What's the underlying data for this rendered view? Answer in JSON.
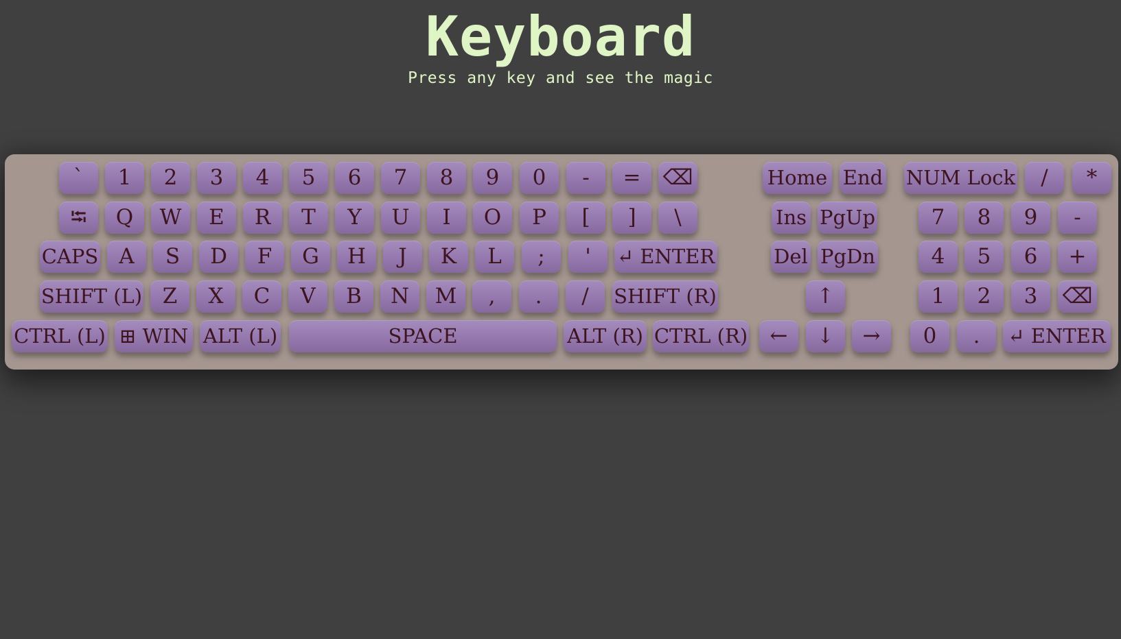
{
  "header": {
    "title": "Keyboard",
    "subtitle": "Press any key and see the magic"
  },
  "keyboard": {
    "main_rows": [
      [
        "`",
        "1",
        "2",
        "3",
        "4",
        "5",
        "6",
        "7",
        "8",
        "9",
        "0",
        "-",
        "=",
        "⌫"
      ],
      [
        "⭾",
        "Q",
        "W",
        "E",
        "R",
        "T",
        "Y",
        "U",
        "I",
        "O",
        "P",
        "[",
        "]",
        "\\"
      ],
      [
        "CAPS",
        "A",
        "S",
        "D",
        "F",
        "G",
        "H",
        "J",
        "K",
        "L",
        ";",
        "'",
        "↵ ENTER"
      ],
      [
        "SHIFT (L)",
        "Z",
        "X",
        "C",
        "V",
        "B",
        "N",
        "M",
        ",",
        ".",
        "/",
        "SHIFT (R)"
      ],
      [
        "CTRL (L)",
        "⊞ WIN",
        "ALT (L)",
        "SPACE",
        "ALT (R)",
        "CTRL (R)"
      ]
    ],
    "nav_rows": [
      [
        "Home",
        "End"
      ],
      [
        "Ins",
        "PgUp"
      ],
      [
        "Del",
        "PgDn"
      ],
      [
        "↑"
      ],
      [
        "←",
        "↓",
        "→"
      ]
    ],
    "numpad_rows": [
      [
        "NUM Lock",
        "/",
        "*"
      ],
      [
        "7",
        "8",
        "9",
        "-"
      ],
      [
        "4",
        "5",
        "6",
        "+"
      ],
      [
        "1",
        "2",
        "3",
        "⌫"
      ],
      [
        "0",
        ".",
        "↵ ENTER"
      ]
    ]
  },
  "colors": {
    "background": "#404040",
    "board": "#a59690",
    "key": "#9a7fb2",
    "key_text": "#3d1420",
    "title": "#dff5c6"
  }
}
